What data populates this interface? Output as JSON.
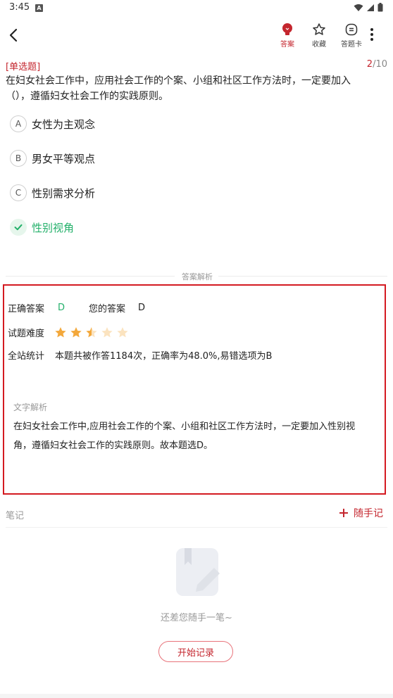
{
  "status": {
    "time": "3:45",
    "app_badge": "A"
  },
  "header": {
    "buttons": [
      {
        "label": "答案",
        "icon": "bulb-icon",
        "color": "#c4262e"
      },
      {
        "label": "收藏",
        "icon": "star-outline-icon"
      },
      {
        "label": "答题卡",
        "icon": "answer-card-icon"
      }
    ]
  },
  "question": {
    "type": "[单选题]",
    "current": "2",
    "total": "/10",
    "text": "在妇女社会工作中，应用社会工作的个案、小组和社区工作方法时，一定要加入（），遵循妇女社会工作的实践原则。",
    "options": [
      {
        "letter": "A",
        "text": "女性为主观念"
      },
      {
        "letter": "B",
        "text": "男女平等观点"
      },
      {
        "letter": "C",
        "text": "性别需求分析"
      },
      {
        "letter": "D",
        "text": "性别视角",
        "correct": true
      }
    ]
  },
  "analysis_section": {
    "divider_label": "答案解析",
    "correct_label": "正确答案",
    "correct_value": "D",
    "yours_label": "您的答案",
    "yours_value": "D",
    "difficulty_label": "试题难度",
    "difficulty_rating": 2.5,
    "difficulty_max": 5,
    "stats_label": "全站统计",
    "stats_text": "本题共被作答1184次，正确率为48.0%,易错选项为B",
    "text_analysis_label": "文字解析",
    "text_analysis": "在妇女社会工作中,应用社会工作的个案、小组和社区工作方法时，一定要加入性别视角，遵循妇女社会工作的实践原则。故本题选D。"
  },
  "notes": {
    "title": "笔记",
    "add_label": "随手记",
    "empty_text": "还差您随手一笔~",
    "start_button": "开始记录"
  },
  "colors": {
    "accent": "#c4262e",
    "correct": "#23b06a",
    "star": "#f3a83b",
    "star_empty": "#fbe3bf"
  }
}
